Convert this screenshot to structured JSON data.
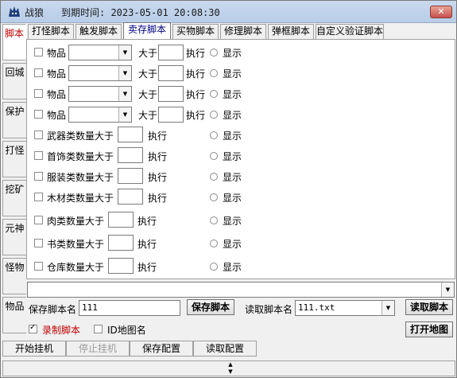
{
  "app": {
    "title": "战狼",
    "expiry_label": "到期时间: 2023-05-01 20:08:30",
    "close_symbol": "✕"
  },
  "side_tabs": [
    {
      "label": "脚本",
      "active": true
    },
    {
      "label": "回城"
    },
    {
      "label": "保护"
    },
    {
      "label": "打怪"
    },
    {
      "label": "挖矿"
    },
    {
      "label": "元神"
    },
    {
      "label": "怪物"
    },
    {
      "label": "物品"
    }
  ],
  "top_tabs": [
    {
      "label": "打怪脚本"
    },
    {
      "label": "触发脚本"
    },
    {
      "label": "卖存脚本",
      "active": true
    },
    {
      "label": "买物脚本"
    },
    {
      "label": "修理脚本"
    },
    {
      "label": "弹框脚本"
    },
    {
      "label": "自定义验证脚本"
    }
  ],
  "item_rows": [
    {
      "label": "物品",
      "greater": "大于",
      "exec": "执行",
      "show": "显示",
      "value": ""
    },
    {
      "label": "物品",
      "greater": "大于",
      "exec": "执行",
      "show": "显示",
      "value": ""
    },
    {
      "label": "物品",
      "greater": "大于",
      "exec": "执行",
      "show": "显示",
      "value": ""
    },
    {
      "label": "物品",
      "greater": "大于",
      "exec": "执行",
      "show": "显示",
      "value": ""
    }
  ],
  "category_rows": [
    {
      "label": "武器类数量大于",
      "exec": "执行",
      "show": "显示"
    },
    {
      "label": "首饰类数量大于",
      "exec": "执行",
      "show": "显示"
    },
    {
      "label": "服装类数量大于",
      "exec": "执行",
      "show": "显示"
    },
    {
      "label": "木材类数量大于",
      "exec": "执行",
      "show": "显示"
    },
    {
      "label": "肉类数量大于",
      "exec": "执行",
      "show": "显示"
    },
    {
      "label": "书类数量大于",
      "exec": "执行",
      "show": "显示"
    },
    {
      "label": "仓库数量大于",
      "exec": "执行",
      "show": "显示"
    }
  ],
  "script_combo": {
    "value": ""
  },
  "save": {
    "label": "保存脚本名",
    "value": "111",
    "button": "保存脚本"
  },
  "load": {
    "label": "读取脚本名",
    "value": "111.txt",
    "button": "读取脚本"
  },
  "record": {
    "label": "录制脚本",
    "checked": true,
    "color": "#c00000"
  },
  "id_map": {
    "label": "ID地图名",
    "checked": false
  },
  "open_map_button": "打开地图",
  "bottom_buttons": [
    {
      "label": "开始挂机"
    },
    {
      "label": "停止挂机",
      "disabled": true
    },
    {
      "label": "保存配置"
    },
    {
      "label": "读取配置"
    }
  ]
}
